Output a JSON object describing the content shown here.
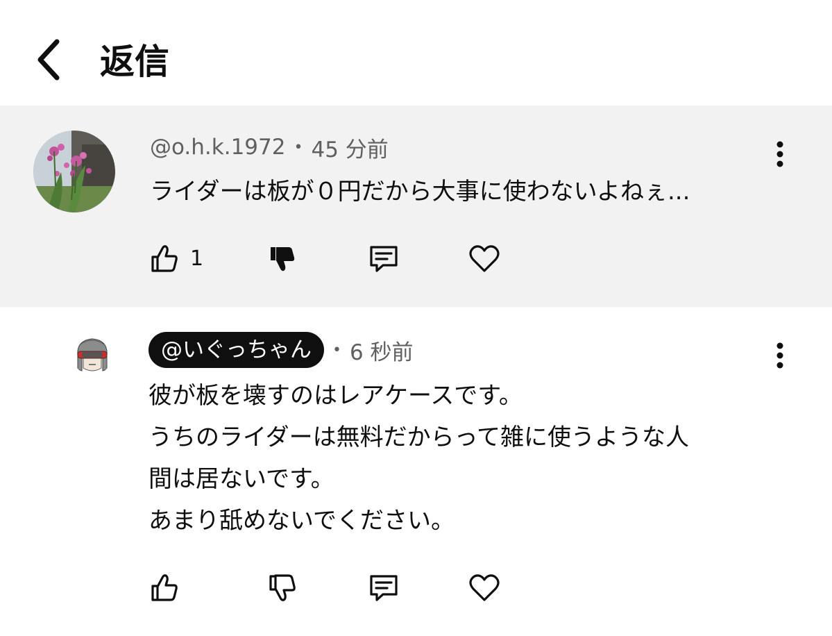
{
  "header": {
    "title": "返信",
    "back_icon": "chevron-left-icon"
  },
  "colors": {
    "parent_bg": "#f2f2f2",
    "text": "#0f0f0f",
    "meta": "#606060",
    "pill_bg": "#0f0f0f"
  },
  "parent_comment": {
    "handle": "@o.h.k.1972",
    "separator": "•",
    "time": "45 分前",
    "text": "ライダーは板が０円だから大事に使わないよねぇ...",
    "like_count": "1",
    "disliked": true,
    "avatar": "flower-photo-avatar"
  },
  "reply_comment": {
    "handle": "@いぐっちゃん",
    "separator": "•",
    "time": "6 秒前",
    "lines": [
      "彼が板を壊すのはレアケースです。",
      "うちのライダーは無料だからって雑に使うような人",
      "間は居ないです。",
      "あまり舐めないでください。"
    ],
    "avatar": "goggles-character-avatar"
  }
}
